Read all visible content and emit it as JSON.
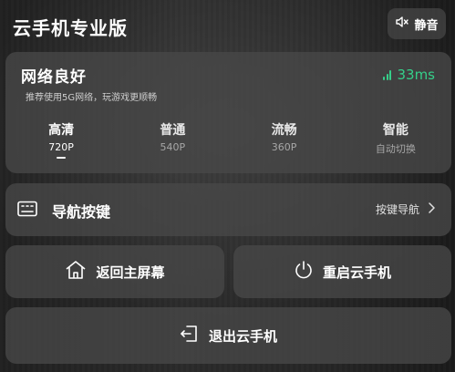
{
  "header": {
    "title": "云手机专业版",
    "mute_label": "静音"
  },
  "network": {
    "status": "网络良好",
    "hint": "推荐使用5G网络，玩游戏更顺畅",
    "latency": "33ms",
    "latency_color": "#35d08a",
    "quality_options": [
      {
        "label": "高清",
        "sub": "720P",
        "selected": true
      },
      {
        "label": "普通",
        "sub": "540P",
        "selected": false
      },
      {
        "label": "流畅",
        "sub": "360P",
        "selected": false
      },
      {
        "label": "智能",
        "sub": "自动切换",
        "selected": false
      }
    ]
  },
  "nav_keys": {
    "label": "导航按键",
    "value": "按键导航"
  },
  "actions": {
    "home_label": "返回主屏幕",
    "restart_label": "重启云手机",
    "exit_label": "退出云手机"
  }
}
